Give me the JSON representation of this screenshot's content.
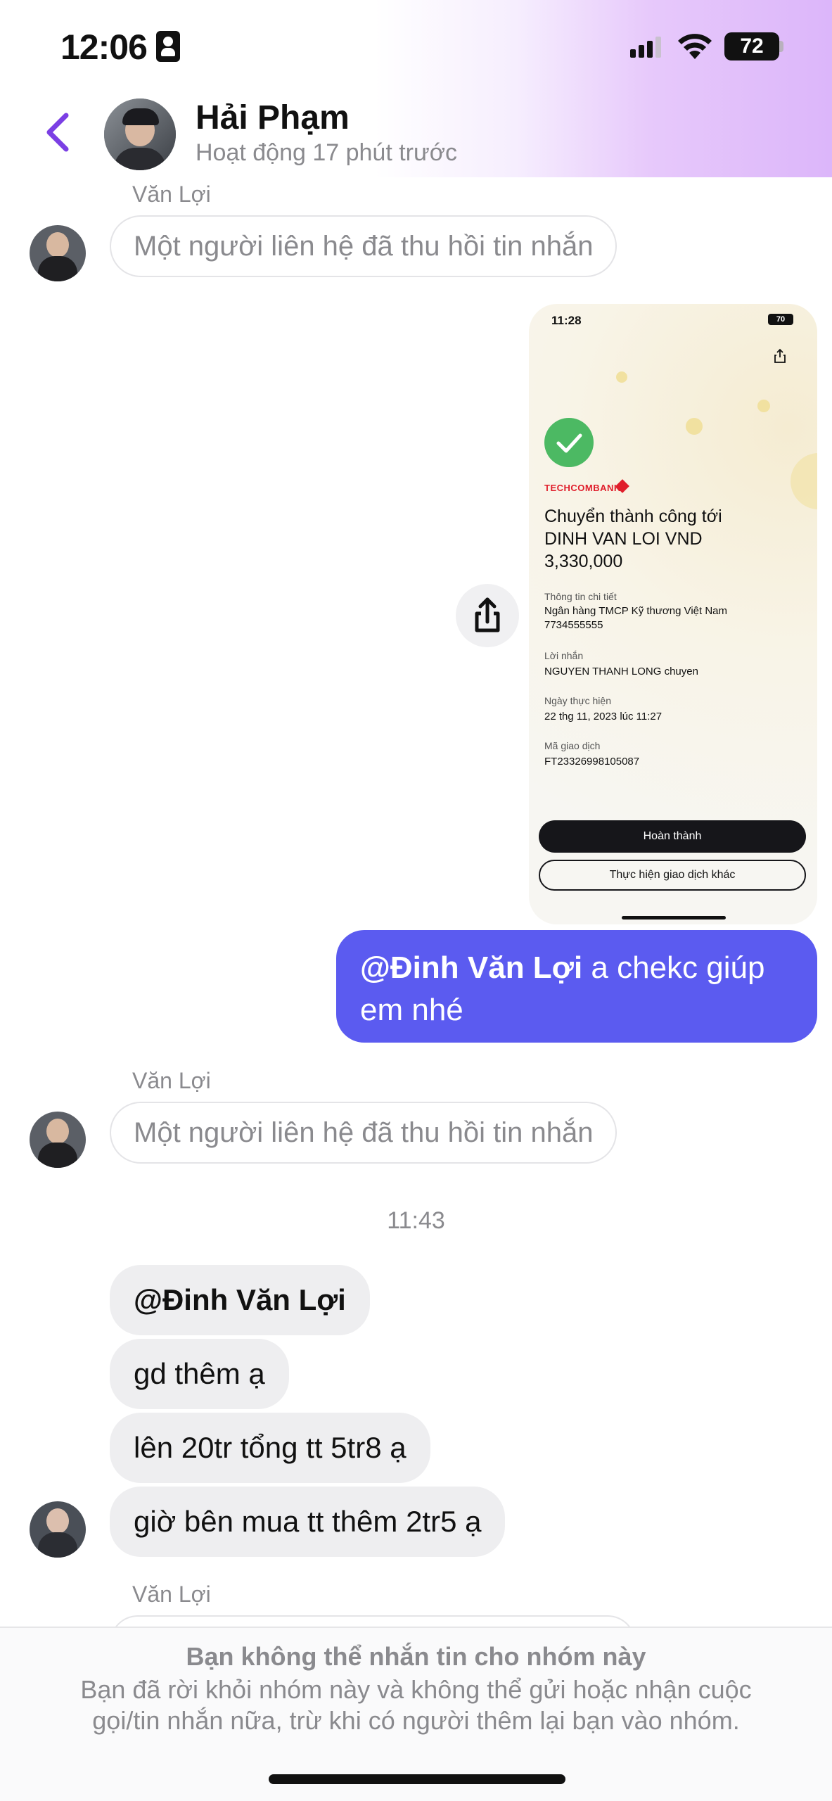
{
  "status_bar": {
    "time": "12:06",
    "battery": "72"
  },
  "header": {
    "contact_name": "Hải Phạm",
    "contact_status": "Hoạt động 17 phút trước"
  },
  "messages": {
    "sender_1": "Văn Lợi",
    "revoked_1": "Một người liên hệ đã thu hồi tin nhắn",
    "outgoing_mention": "@Đinh Văn Lợi",
    "outgoing_text": " a chekc giúp em nhé",
    "sender_2": "Văn Lợi",
    "revoked_2": "Một người liên hệ đã thu hồi tin nhắn",
    "timestamp": "11:43",
    "incoming": [
      "@Đinh Văn Lợi",
      "gd thêm ạ",
      "lên 20tr tổng tt 5tr8 ạ",
      "giờ bên mua tt thêm 2tr5 ạ"
    ],
    "sender_3": "Văn Lợi"
  },
  "screenshot": {
    "time": "11:28",
    "battery": "70",
    "bank": "TECHCOMBANK",
    "title": "Chuyển thành công tới DINH VAN LOI VND 3,330,000",
    "details_label": "Thông tin chi tiết",
    "details_bank": "Ngân hàng TMCP Kỹ thương Việt Nam",
    "details_account": "7734555555",
    "message_label": "Lời nhắn",
    "message_value": "NGUYEN THANH LONG chuyen",
    "date_label": "Ngày thực hiện",
    "date_value": "22 thg 11, 2023 lúc 11:27",
    "txn_label": "Mã giao dịch",
    "txn_value": "FT23326998105087",
    "done_button": "Hoàn thành",
    "other_button": "Thực hiện giao dịch khác"
  },
  "notice": {
    "title": "Bạn không thể nhắn tin cho nhóm này",
    "body": "Bạn đã rời khỏi nhóm này và không thể gửi hoặc nhận cuộc gọi/tin nhắn nữa, trừ khi có người thêm lại bạn vào nhóm."
  },
  "colors": {
    "accent": "#7b3fe4",
    "outgoing_bubble": "#5b5bf0",
    "incoming_bubble": "#eeeef0",
    "success": "#4cb963"
  }
}
